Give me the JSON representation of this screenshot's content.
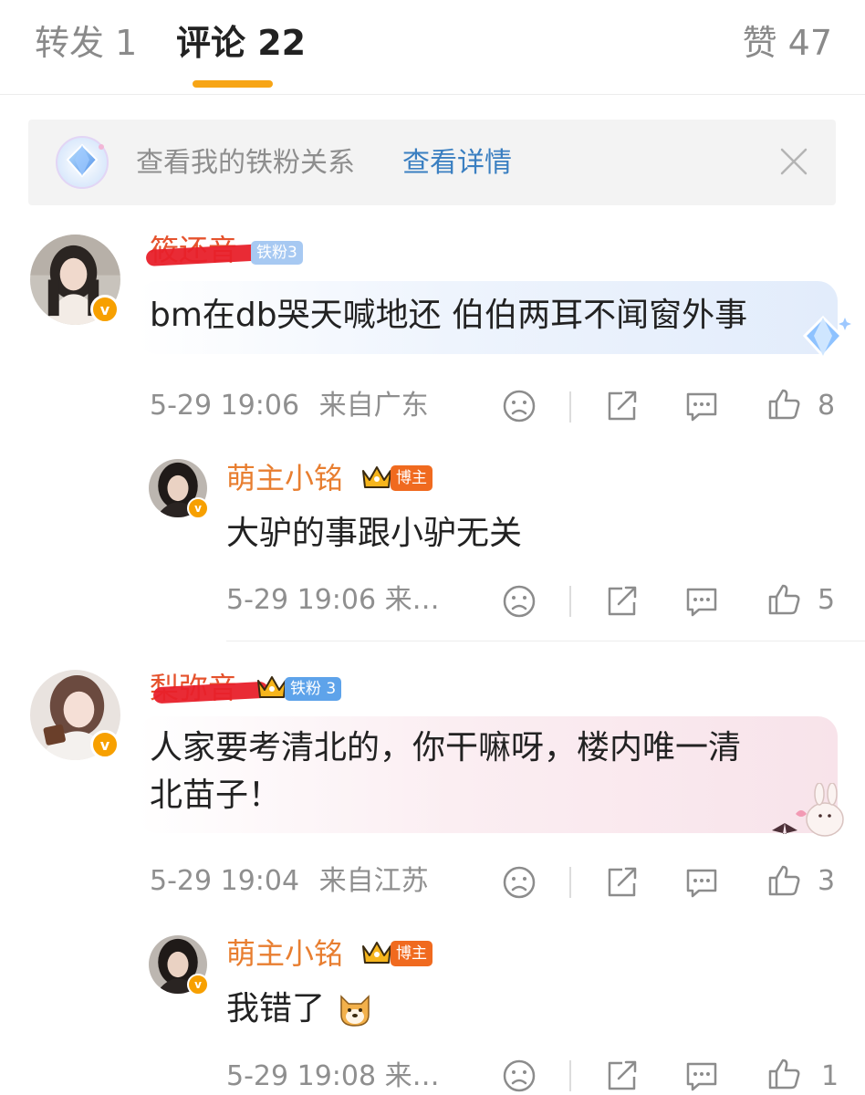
{
  "tabs": {
    "forward": "转发 1",
    "comments": "评论 22",
    "likes": "赞 47"
  },
  "banner": {
    "text": "查看我的铁粉关系",
    "link": "查看详情"
  },
  "comments": [
    {
      "username": "筱还音",
      "fan_badge": "铁粉3",
      "text": "bm在db哭天喊地还 伯伯两耳不闻窗外事",
      "time": "5-29 19:06",
      "location": "来自广东",
      "likes": "8",
      "reply": {
        "username": "萌主小铭",
        "host_badge": "博主",
        "text": "大驴的事跟小驴无关",
        "meta": "5-29 19:06 来…",
        "likes": "5"
      }
    },
    {
      "username": "梨弥音",
      "fan_badge": "铁粉 3",
      "text_line1": "人家要考清北的，你干嘛呀，楼内唯一清",
      "text_line2": "北苗子！",
      "time": "5-29 19:04",
      "location": "来自江苏",
      "likes": "3",
      "reply": {
        "username": "萌主小铭",
        "host_badge": "博主",
        "text": "我错了",
        "meta": "5-29 19:08 来…",
        "likes": "1"
      }
    }
  ],
  "colors": {
    "accent": "#f7a516",
    "link": "#3a7fc1",
    "username": "#e87e30",
    "verified": "#f7a000",
    "fan_badge": "#5ea3ea",
    "host_badge": "#f06a1f"
  }
}
